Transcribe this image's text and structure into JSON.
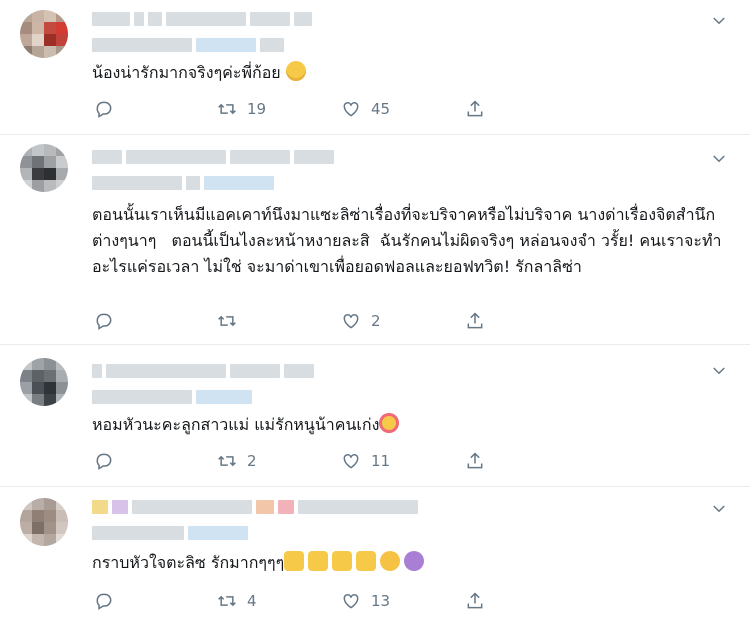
{
  "tweets": [
    {
      "text": "น้องน่ารักมากจริงๆค่ะพี่ก้อย",
      "emojis": [
        "relieved-face"
      ],
      "replies": "",
      "retweets": "19",
      "likes": "45"
    },
    {
      "text": "ตอนนั้นเราเห็นมีแอคเคาท์นึงมาแซะลิซ่าเรื่องที่จะบริจาคหรือไม่บริจาค นางด่าเรื่องจิตสำนึกต่างๆนาๆ   ตอนนี้เป็นไงละหน้าหงายละสิ  ฉันรักคนไม่ผิดจริงๆ หล่อนจงจำ วรั้ย! คนเราจะทำอะไรแค่รอเวลา ไม่ใช่ จะมาด่าเขาเพื่อยอดฟอลและยอฟทวิต! รักลาลิซ่า",
      "emojis": [],
      "replies": "",
      "retweets": "",
      "likes": "2"
    },
    {
      "text": "หอมหัวนะคะลูกสาวแม่ แม่รักหนูน้าคนเก่ง",
      "emojis": [
        "kissing-face"
      ],
      "replies": "",
      "retweets": "2",
      "likes": "11"
    },
    {
      "text": "กราบหัวใจตะลิซ รักมากๆๆๆ",
      "emojis": [
        "folded-hands",
        "folded-hands",
        "folded-hands",
        "folded-hands",
        "yellow-heart",
        "purple-heart"
      ],
      "replies": "",
      "retweets": "4",
      "likes": "13"
    }
  ],
  "icons": {
    "reply": "reply-icon",
    "retweet": "retweet-icon",
    "like": "heart-icon",
    "share": "share-icon",
    "more": "chevron-down-icon"
  },
  "colors": {
    "text": "#14171a",
    "muted": "#657786",
    "divider": "#e6ecf0"
  }
}
